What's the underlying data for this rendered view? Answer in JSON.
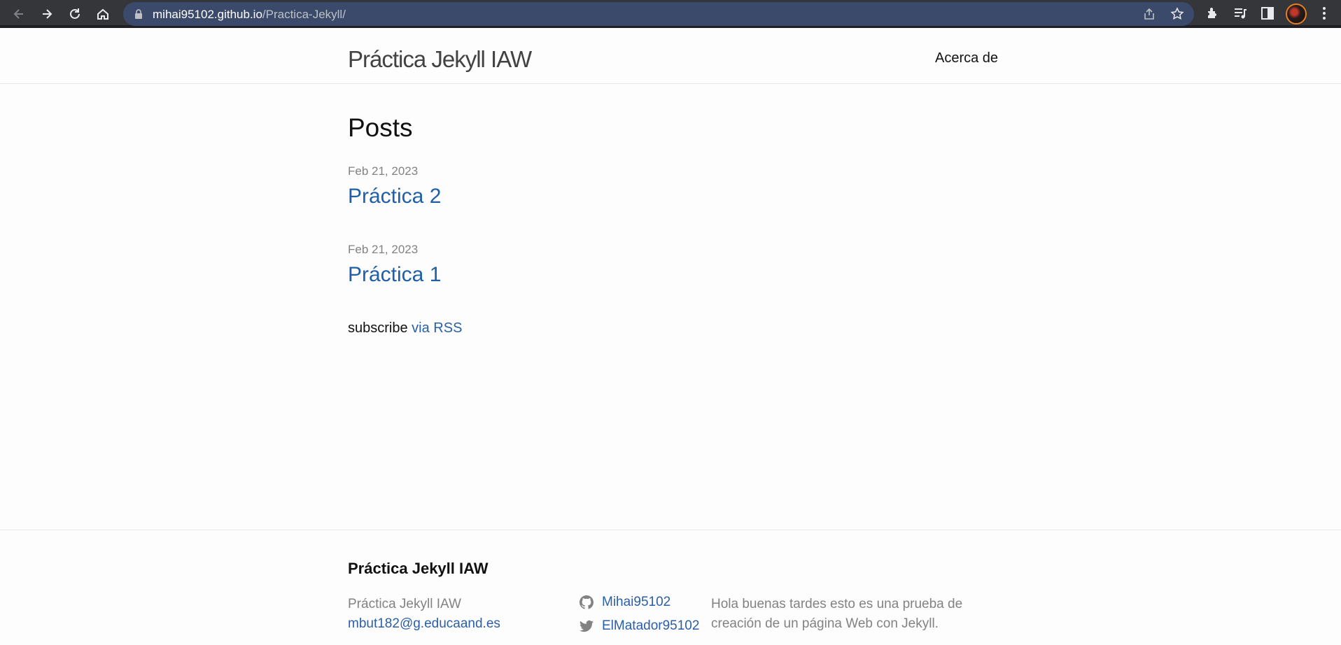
{
  "browser": {
    "url_host": "mihai95102.github.io",
    "url_path": "/Practica-Jekyll/",
    "icons": [
      "back-icon",
      "forward-icon",
      "reload-icon",
      "home-icon",
      "lock-icon",
      "share-icon",
      "star-icon",
      "extensions-icon",
      "media-icon",
      "side-panel-icon",
      "profile-avatar",
      "menu-icon"
    ]
  },
  "header": {
    "site_title": "Práctica Jekyll IAW",
    "nav_about": "Acerca de"
  },
  "main": {
    "heading": "Posts",
    "posts": [
      {
        "date": "Feb 21, 2023",
        "title": "Práctica 2"
      },
      {
        "date": "Feb 21, 2023",
        "title": "Práctica 1"
      }
    ],
    "rss_prefix": "subscribe",
    "rss_link": "via RSS"
  },
  "footer": {
    "heading": "Práctica Jekyll IAW",
    "name": "Práctica Jekyll IAW",
    "email": "mbut182@g.educaand.es",
    "github_user": "Mihai95102",
    "twitter_user": "ElMatador95102",
    "description": "Hola buenas tardes esto es una prueba de creación de un página Web con Jekyll."
  },
  "colors": {
    "link": "#2a5fa8",
    "meta": "#828282",
    "omnibox": "#3b4a6b",
    "chrome": "#35363a"
  }
}
